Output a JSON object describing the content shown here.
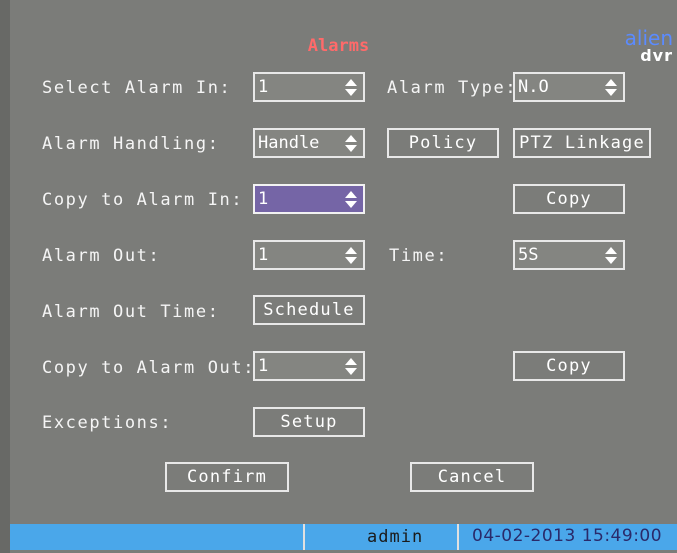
{
  "window": {
    "title": "Alarms"
  },
  "logo": {
    "top": "alien",
    "bottom": "dvr"
  },
  "labels": {
    "select_alarm_in": "Select Alarm In:",
    "alarm_type": "Alarm Type:",
    "alarm_handling": "Alarm Handling:",
    "copy_to_alarm_in": "Copy to Alarm In:",
    "alarm_out": "Alarm Out:",
    "time": "Time:",
    "alarm_out_time": "Alarm Out Time:",
    "copy_to_alarm_out": "Copy to Alarm Out:",
    "exceptions": "Exceptions:"
  },
  "fields": {
    "select_alarm_in": "1",
    "alarm_type": "N.O",
    "alarm_handling": "Handle",
    "copy_to_alarm_in": "1",
    "alarm_out": "1",
    "time": "5S",
    "copy_to_alarm_out": "1"
  },
  "buttons": {
    "policy": "Policy",
    "ptz_linkage": "PTZ Linkage",
    "copy_in": "Copy",
    "schedule": "Schedule",
    "copy_out": "Copy",
    "setup": "Setup",
    "confirm": "Confirm",
    "cancel": "Cancel"
  },
  "status_bar": {
    "user": "admin",
    "datetime": "04-02-2013 15:49:00"
  },
  "colors": {
    "background": "#7b7c79",
    "title": "#ff6a6a",
    "focus": "#7565a6",
    "status": "#4aa7ea",
    "logo": "#5b8bff"
  }
}
